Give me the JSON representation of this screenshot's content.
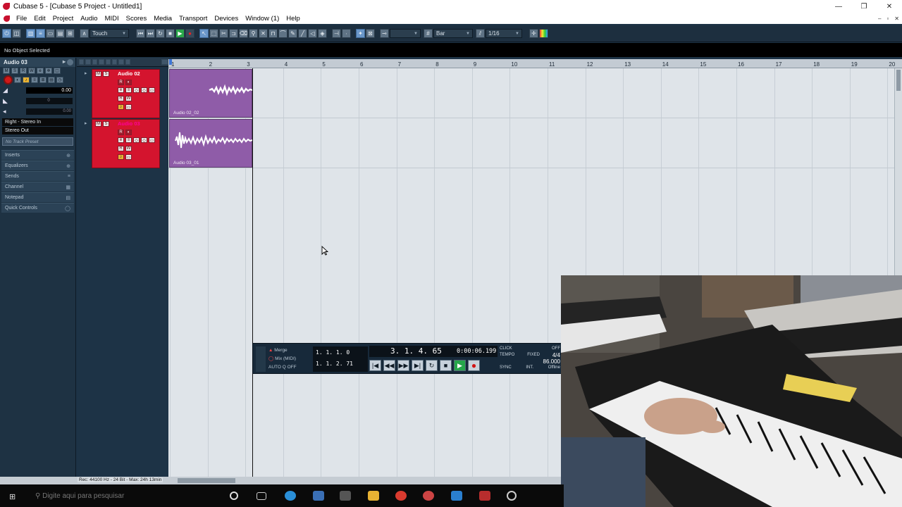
{
  "window": {
    "title": "Cubase 5 - [Cubase 5 Project - Untitled1]",
    "controls": [
      "—",
      "❐",
      "✕"
    ]
  },
  "menu": {
    "items": [
      "File",
      "Edit",
      "Project",
      "Audio",
      "MIDI",
      "Scores",
      "Media",
      "Transport",
      "Devices",
      "Window (1)",
      "Help"
    ],
    "mdi_controls": [
      "–",
      "▫",
      "✕"
    ]
  },
  "toolbar": {
    "automation_mode": "Touch",
    "grid_type": "Bar",
    "quantize": "1/16",
    "transport_glyphs": {
      "play": "▶",
      "rec": "●",
      "stop": "■",
      "cycle": "↻"
    }
  },
  "infoline": {
    "text": "No Object Selected"
  },
  "inspector": {
    "track_name": "Audio 03",
    "volume": "0.00",
    "pan": "0",
    "delay": "0.00",
    "input": "Right - Stereo In",
    "output": "Stereo Out",
    "preset_placeholder": "No Track Preset",
    "sections": [
      "Inserts",
      "Equalizers",
      "Sends",
      "Channel",
      "Notepad",
      "Quick Controls"
    ],
    "section_icons": [
      "⊕",
      "⊕",
      "≡",
      "▦",
      "▤",
      "◯"
    ]
  },
  "tracks": [
    {
      "name": "Audio 02",
      "number": "1",
      "event": "Audio 02_02",
      "color": "#d4142e"
    },
    {
      "name": "Audio 03",
      "number": "2",
      "event": "Audio 03_01",
      "color": "#d4142e"
    }
  ],
  "ruler": {
    "bars": [
      "1",
      "2",
      "3",
      "4",
      "5",
      "6",
      "7",
      "8",
      "9",
      "10",
      "11",
      "12",
      "13",
      "14",
      "15",
      "16",
      "17",
      "18",
      "19",
      "20"
    ]
  },
  "transport": {
    "mode": "Merge",
    "mix": "Mix (MIDI)",
    "auto_q": "AUTO Q",
    "auto_q_state": "OFF",
    "left_locator": "1. 1. 1. 0",
    "right_locator": "1. 1. 2. 71",
    "position_bars": "3. 1. 4. 65",
    "position_time": "0:00:06.199",
    "click_label": "CLICK",
    "click_state": "OFF",
    "tempo_label": "TEMPO",
    "tempo_mode": "FIXED",
    "signature": "4/4",
    "tempo": "86.000",
    "sync_label": "SYNC",
    "sync_mode": "INT.",
    "sync_state": "Offline",
    "buttons": [
      "|◀",
      "◀◀",
      "▶▶",
      "▶|",
      "↻",
      "■",
      "▶",
      "●"
    ]
  },
  "status": {
    "record_format": "Rec: 44100 Hz - 24 Bit - Max: 24h 13min"
  },
  "taskbar": {
    "search_placeholder": "Digite aqui para pesquisar"
  }
}
